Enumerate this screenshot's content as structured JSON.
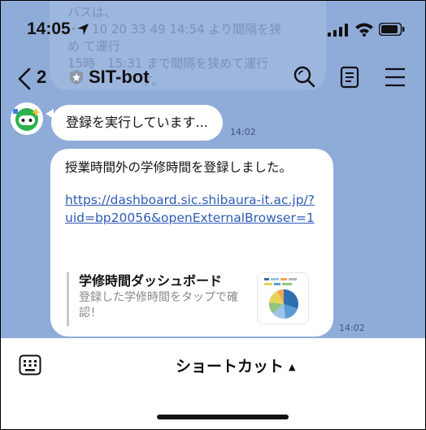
{
  "status_bar": {
    "time": "14:05",
    "location_icon": "location-arrow-icon",
    "signal_icon": "cellular-signal-icon",
    "wifi_icon": "wifi-icon",
    "battery_icon": "battery-icon"
  },
  "ghost_text": {
    "lines": [
      "バスは、",
      "・　10 20 33 49 14:54 より間隔を狭",
      "め て運行",
      "15時　15:31 まで間隔を狭めて運行",
      "・　　　　　す。"
    ]
  },
  "nav": {
    "back_count": "2",
    "title": "SIT-bot",
    "icons": [
      "chevron-left-icon",
      "shield-icon",
      "search-icon",
      "notes-icon",
      "menu-icon"
    ]
  },
  "messages": [
    {
      "text": "登録を実行しています...",
      "time": "14:02"
    },
    {
      "text": "授業時間外の学修時間を登録しました。",
      "link": "https://dashboard.sic.shibaura-it.ac.jp/?uid=bp20056&openExternalBrowser=1",
      "preview": {
        "title": "学修時間ダッシュボード",
        "description": "登録した学修時間をタップで確認！"
      },
      "time": "14:02"
    }
  ],
  "bottom_bar": {
    "shortcut_label": "ショートカット",
    "caret": "▲"
  },
  "colors": {
    "chat_background": "#8fabd8",
    "bubble": "#ffffff",
    "link": "#2e5bb5",
    "bot_accent": "#2bb24c"
  }
}
